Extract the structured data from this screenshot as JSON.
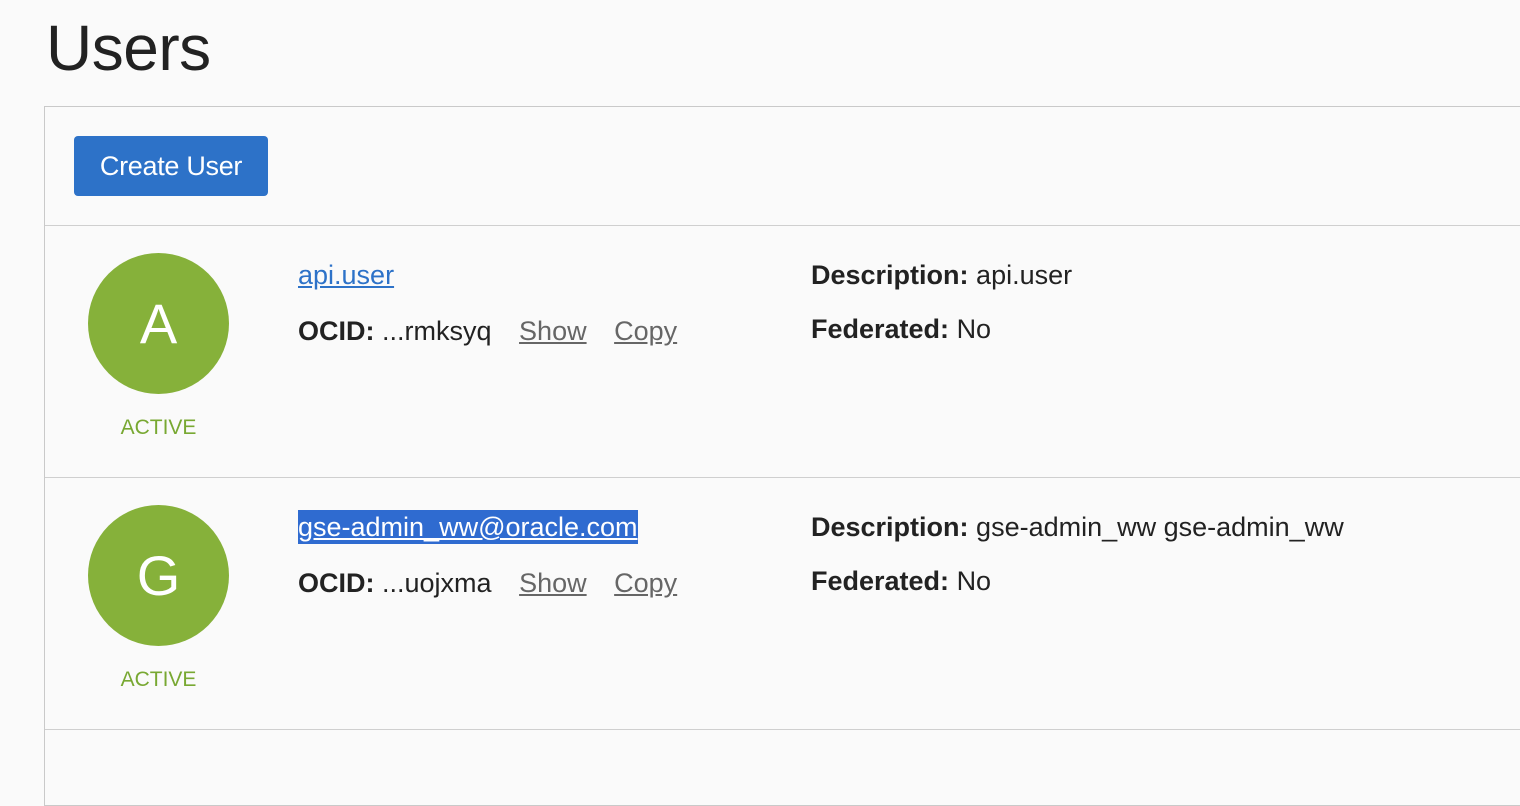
{
  "page": {
    "title": "Users"
  },
  "toolbar": {
    "create_label": "Create User"
  },
  "labels": {
    "ocid": "OCID:",
    "description": "Description:",
    "federated": "Federated:",
    "show": "Show",
    "copy": "Copy"
  },
  "users": [
    {
      "initial": "A",
      "status": "ACTIVE",
      "name": "api.user",
      "ocid": "...rmksyq",
      "description": "api.user",
      "federated": "No"
    },
    {
      "initial": "G",
      "status": "ACTIVE",
      "name": "gse-admin_ww@oracle.com",
      "ocid": "...uojxma",
      "description": "gse-admin_ww gse-admin_ww",
      "federated": "No"
    }
  ],
  "colors": {
    "accent": "#2d72c8",
    "avatar": "#86b13a",
    "status_active": "#78a832",
    "selection": "#2f6bd0"
  }
}
